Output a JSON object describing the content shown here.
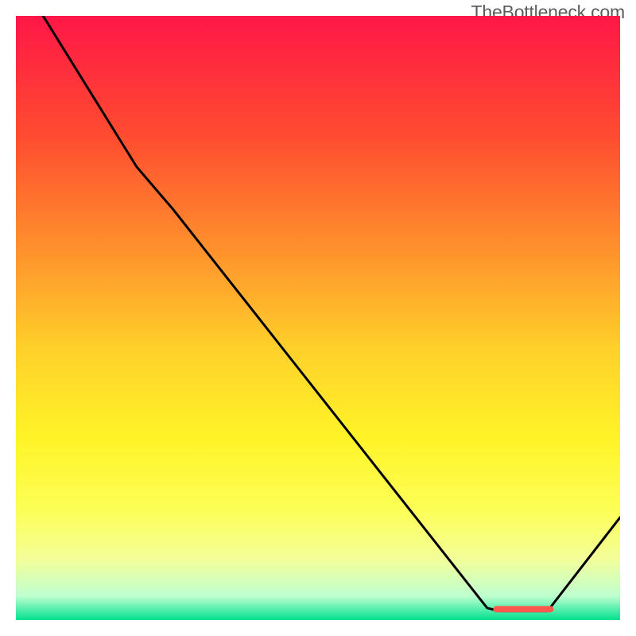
{
  "watermark": "TheBottleneck.com",
  "chart_data": {
    "type": "line",
    "title": "",
    "xlabel": "",
    "ylabel": "",
    "xlim": [
      0,
      100
    ],
    "ylim": [
      0,
      100
    ],
    "grid": false,
    "series": [
      {
        "name": "curve",
        "x": [
          4.5,
          20,
          26,
          78,
          80,
          88,
          100
        ],
        "y": [
          100,
          75,
          68,
          2,
          1.5,
          1.5,
          17
        ]
      }
    ],
    "background_gradient": {
      "stops": [
        {
          "offset": 0.0,
          "color": "#ff1747"
        },
        {
          "offset": 0.2,
          "color": "#ff4c30"
        },
        {
          "offset": 0.4,
          "color": "#ff962c"
        },
        {
          "offset": 0.55,
          "color": "#ffd02a"
        },
        {
          "offset": 0.7,
          "color": "#fff428"
        },
        {
          "offset": 0.82,
          "color": "#fdff58"
        },
        {
          "offset": 0.9,
          "color": "#f2ff9a"
        },
        {
          "offset": 0.96,
          "color": "#bfffd0"
        },
        {
          "offset": 1.0,
          "color": "#00e18f"
        }
      ]
    },
    "optimal_marker": {
      "x_start": 79,
      "x_end": 89,
      "y": 1.8,
      "color": "#ff5a4d"
    }
  }
}
